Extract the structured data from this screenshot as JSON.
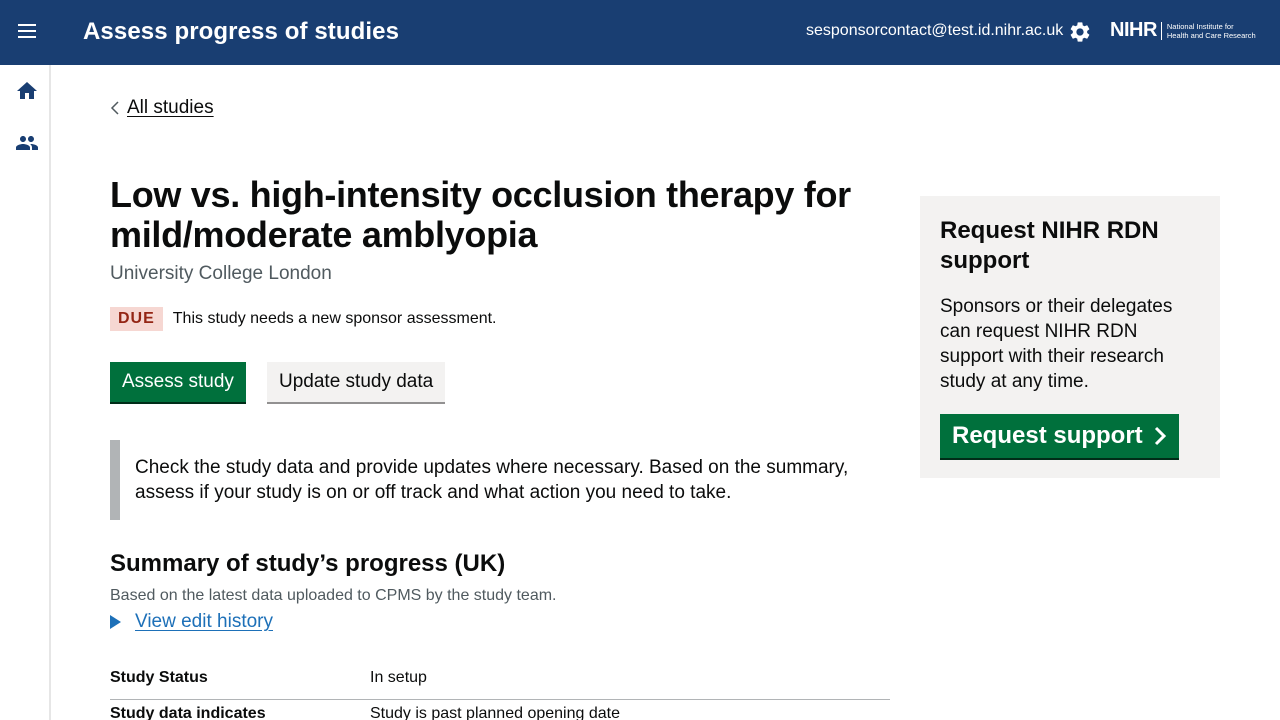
{
  "header": {
    "title": "Assess progress of studies",
    "user_email": "sesponsorcontact@test.id.nihr.ac.uk",
    "logo_mark": "NIHR",
    "logo_line1": "National Institute for",
    "logo_line2": "Health and Care Research"
  },
  "sidebar": {
    "items": [
      {
        "icon": "home-icon"
      },
      {
        "icon": "people-icon"
      }
    ]
  },
  "breadcrumb": {
    "back_label": "All studies"
  },
  "study": {
    "title": "Low vs. high-intensity occlusion therapy for mild/moderate amblyopia",
    "organisation": "University College London",
    "due_tag": "DUE",
    "due_text": "This study needs a new sponsor assessment.",
    "assess_button": "Assess study",
    "update_button": "Update study data",
    "inset_text": "Check the study data and provide updates where necessary. Based on the summary, assess if your study is on or off track and what action you need to take."
  },
  "summary": {
    "title": "Summary of study’s progress (UK)",
    "subtitle": "Based on the latest data uploaded to CPMS by the study team.",
    "history_link": "View edit history",
    "rows": [
      {
        "key": "Study Status",
        "value": "In setup"
      },
      {
        "key": "Study data indicates",
        "value": "Study is past planned opening date"
      }
    ]
  },
  "panel": {
    "title": "Request NIHR RDN support",
    "body": "Sponsors or their delegates can request NIHR RDN support with their research study at any time.",
    "button": "Request support"
  },
  "colors": {
    "header_bg": "#193e72",
    "primary_green": "#00703c",
    "link_blue": "#1d70b8",
    "due_bg": "#f6d7d2",
    "due_text": "#942514"
  }
}
